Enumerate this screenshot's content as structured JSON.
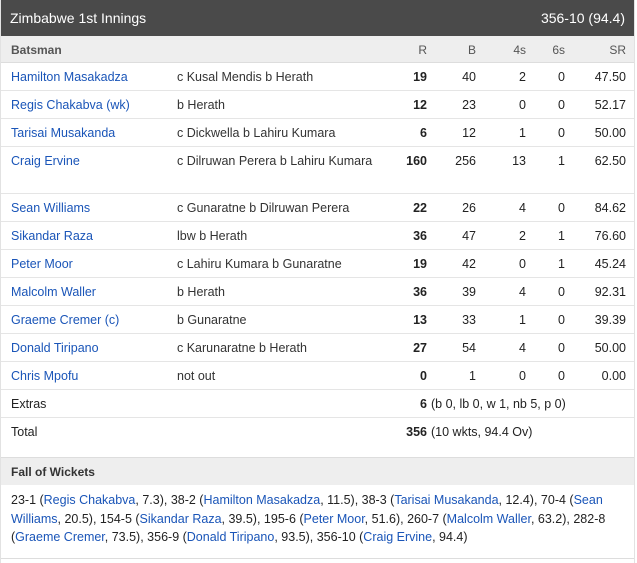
{
  "header": {
    "title": "Zimbabwe 1st Innings",
    "score": "356-10 (94.4)"
  },
  "columns": {
    "batsman": "Batsman",
    "r": "R",
    "b": "B",
    "fours": "4s",
    "sixes": "6s",
    "sr": "SR"
  },
  "batsmen": [
    {
      "name": "Hamilton Masakadza",
      "dismissal": "c Kusal Mendis b Herath",
      "r": "19",
      "b": "40",
      "fours": "2",
      "sixes": "0",
      "sr": "47.50"
    },
    {
      "name": "Regis Chakabva (wk)",
      "dismissal": "b Herath",
      "r": "12",
      "b": "23",
      "fours": "0",
      "sixes": "0",
      "sr": "52.17"
    },
    {
      "name": "Tarisai Musakanda",
      "dismissal": "c Dickwella b Lahiru Kumara",
      "r": "6",
      "b": "12",
      "fours": "1",
      "sixes": "0",
      "sr": "50.00"
    },
    {
      "name": "Craig Ervine",
      "dismissal": "c Dilruwan Perera b Lahiru Kumara",
      "r": "160",
      "b": "256",
      "fours": "13",
      "sixes": "1",
      "sr": "62.50"
    },
    {
      "name": "Sean Williams",
      "dismissal": "c Gunaratne b Dilruwan Perera",
      "r": "22",
      "b": "26",
      "fours": "4",
      "sixes": "0",
      "sr": "84.62"
    },
    {
      "name": "Sikandar Raza",
      "dismissal": "lbw b Herath",
      "r": "36",
      "b": "47",
      "fours": "2",
      "sixes": "1",
      "sr": "76.60"
    },
    {
      "name": "Peter Moor",
      "dismissal": "c Lahiru Kumara b Gunaratne",
      "r": "19",
      "b": "42",
      "fours": "0",
      "sixes": "1",
      "sr": "45.24"
    },
    {
      "name": "Malcolm Waller",
      "dismissal": "b Herath",
      "r": "36",
      "b": "39",
      "fours": "4",
      "sixes": "0",
      "sr": "92.31"
    },
    {
      "name": "Graeme Cremer (c)",
      "dismissal": "b Gunaratne",
      "r": "13",
      "b": "33",
      "fours": "1",
      "sixes": "0",
      "sr": "39.39"
    },
    {
      "name": "Donald Tiripano",
      "dismissal": "c Karunaratne b Herath",
      "r": "27",
      "b": "54",
      "fours": "4",
      "sixes": "0",
      "sr": "50.00"
    },
    {
      "name": "Chris Mpofu",
      "dismissal": "not out",
      "r": "0",
      "b": "1",
      "fours": "0",
      "sixes": "0",
      "sr": "0.00"
    }
  ],
  "extras": {
    "label": "Extras",
    "total": "6",
    "detail": "(b 0, lb 0, w 1, nb 5, p 0)"
  },
  "total": {
    "label": "Total",
    "runs": "356",
    "detail": "(10 wkts, 94.4 Ov)"
  },
  "fall_of_wickets": {
    "title": "Fall of Wickets",
    "items": [
      {
        "score": "23-1",
        "player": "Regis Chakabva",
        "over": "7.3"
      },
      {
        "score": "38-2",
        "player": "Hamilton Masakadza",
        "over": "11.5"
      },
      {
        "score": "38-3",
        "player": "Tarisai Musakanda",
        "over": "12.4"
      },
      {
        "score": "70-4",
        "player": "Sean Williams",
        "over": "20.5"
      },
      {
        "score": "154-5",
        "player": "Sikandar Raza",
        "over": "39.5"
      },
      {
        "score": "195-6",
        "player": "Peter Moor",
        "over": "51.6"
      },
      {
        "score": "260-7",
        "player": "Malcolm Waller",
        "over": "63.2"
      },
      {
        "score": "282-8",
        "player": "Graeme Cremer",
        "over": "73.5"
      },
      {
        "score": "356-9",
        "player": "Donald Tiripano",
        "over": "93.5"
      },
      {
        "score": "356-10",
        "player": "Craig Ervine",
        "over": "94.4"
      }
    ]
  }
}
